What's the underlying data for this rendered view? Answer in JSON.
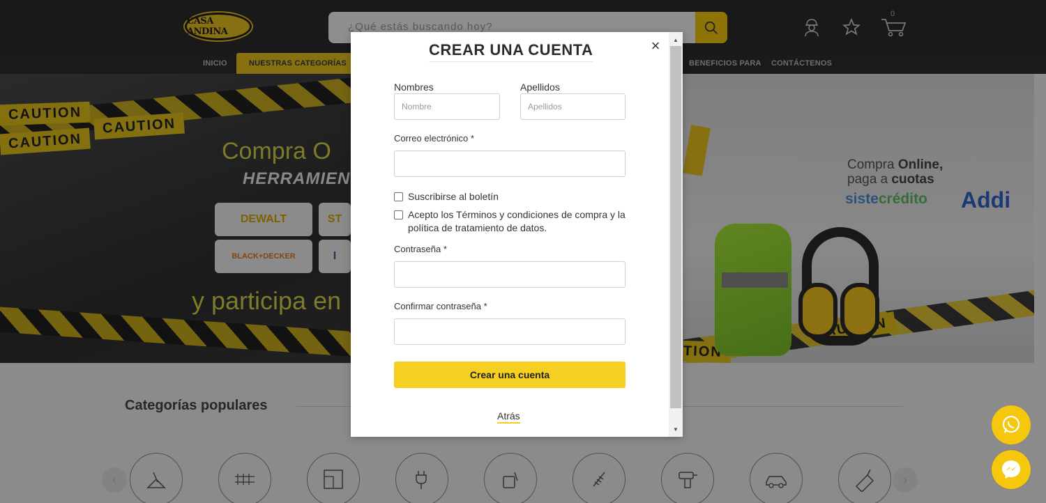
{
  "header": {
    "logo_text": "CASA ANDINA",
    "search_placeholder": "¿Qué estás buscando hoy?",
    "cart_count": "0"
  },
  "nav": {
    "items": [
      {
        "label": "INICIO"
      },
      {
        "label": "NUESTRAS CATEGORÍAS"
      },
      {
        "label": "BENEFICIOS PARA"
      },
      {
        "label": "CONTÁCTENOS"
      }
    ]
  },
  "banner": {
    "caution": "CAUTION",
    "headline1": "Compra O",
    "headline2": "HERRAMIEN",
    "headline3": "y participa en",
    "brands": [
      "DEWALT",
      "ST",
      "BLACK+DECKER",
      "I"
    ],
    "compra_online_1": "Compra",
    "compra_online_1b": "Online,",
    "compra_online_2": "paga a",
    "compra_online_2b": "cuotas",
    "siste": "siste",
    "credito": "crédito",
    "addi": "Addi"
  },
  "categories": {
    "title": "Categorías populares",
    "count": 9
  },
  "colors": {
    "accent": "#f5d023",
    "header_bg": "#2b2b2b",
    "whatsapp": "#f5c70d",
    "messenger": "#f5c70d"
  },
  "modal": {
    "title": "CREAR UNA CUENTA",
    "close_symbol": "×",
    "nombres_label": "Nombres",
    "nombres_placeholder": "Nombre",
    "nombres_value": "",
    "apellidos_label": "Apellidos",
    "apellidos_placeholder": "Apellidos",
    "apellidos_value": "",
    "email_label": "Correo electrónico *",
    "email_value": "",
    "newsletter_label": "Suscribirse al boletín",
    "newsletter_checked": false,
    "terms_label": "Acepto los Términos y condiciones de compra y la política de tratamiento de datos.",
    "terms_checked": false,
    "password_label": "Contraseña *",
    "password_value": "",
    "confirm_label": "Confirmar contraseña *",
    "confirm_value": "",
    "submit_label": "Crear una cuenta",
    "back_label": "Atrás"
  }
}
